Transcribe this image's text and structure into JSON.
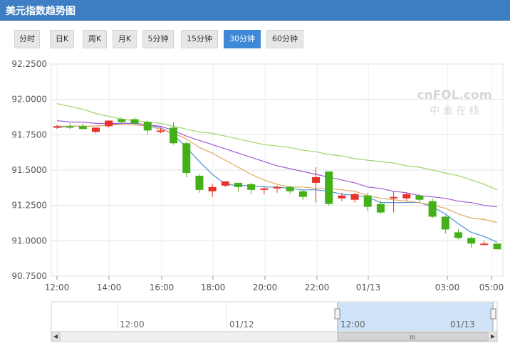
{
  "title": "美元指数趋势图",
  "tabs": [
    {
      "label": "分时",
      "active": false
    },
    {
      "label": "日K",
      "active": false
    },
    {
      "label": "周K",
      "active": false
    },
    {
      "label": "月K",
      "active": false
    },
    {
      "label": "5分钟",
      "active": false
    },
    {
      "label": "15分钟",
      "active": false
    },
    {
      "label": "30分钟",
      "active": true
    },
    {
      "label": "60分钟",
      "active": false
    }
  ],
  "watermark": {
    "brand": "cnFOL.com",
    "subtitle": "中 金 在 线"
  },
  "colors": {
    "up": "#e8312b",
    "down": "#43b017",
    "ma1": "#4a90d9",
    "ma2": "#e0a85a",
    "ma3": "#a55ad6",
    "ma4": "#9ed46b",
    "tab_active": "#3f88d8",
    "title_bar": "#3d7ec4"
  },
  "navigator": {
    "labels": [
      "12:00",
      "01/12",
      "12:00",
      "01/13"
    ],
    "scroll_grip": "III"
  },
  "chart_data": {
    "type": "candlestick",
    "ylim": [
      90.75,
      92.25
    ],
    "yticks": [
      "92.2500",
      "92.0000",
      "91.7500",
      "91.5000",
      "91.2500",
      "91.0000",
      "90.7500"
    ],
    "xticks": [
      "12:00",
      "14:00",
      "16:00",
      "18:00",
      "20:00",
      "22:00",
      "01/13",
      "03:00",
      "05:00"
    ],
    "candles": [
      {
        "o": 91.8,
        "h": 91.82,
        "l": 91.79,
        "c": 91.81
      },
      {
        "o": 91.81,
        "h": 91.83,
        "l": 91.79,
        "c": 91.8
      },
      {
        "o": 91.81,
        "h": 91.83,
        "l": 91.79,
        "c": 91.79
      },
      {
        "o": 91.77,
        "h": 91.8,
        "l": 91.76,
        "c": 91.8
      },
      {
        "o": 91.81,
        "h": 91.85,
        "l": 91.8,
        "c": 91.85
      },
      {
        "o": 91.86,
        "h": 91.87,
        "l": 91.83,
        "c": 91.84
      },
      {
        "o": 91.86,
        "h": 91.87,
        "l": 91.82,
        "c": 91.83
      },
      {
        "o": 91.84,
        "h": 91.85,
        "l": 91.75,
        "c": 91.78
      },
      {
        "o": 91.78,
        "h": 91.8,
        "l": 91.76,
        "c": 91.78
      },
      {
        "o": 91.8,
        "h": 91.84,
        "l": 91.68,
        "c": 91.69
      },
      {
        "o": 91.69,
        "h": 91.7,
        "l": 91.45,
        "c": 91.48
      },
      {
        "o": 91.46,
        "h": 91.47,
        "l": 91.34,
        "c": 91.36
      },
      {
        "o": 91.35,
        "h": 91.4,
        "l": 91.31,
        "c": 91.38
      },
      {
        "o": 91.39,
        "h": 91.42,
        "l": 91.38,
        "c": 91.42
      },
      {
        "o": 91.41,
        "h": 91.41,
        "l": 91.35,
        "c": 91.38
      },
      {
        "o": 91.4,
        "h": 91.41,
        "l": 91.33,
        "c": 91.36
      },
      {
        "o": 91.36,
        "h": 91.38,
        "l": 91.33,
        "c": 91.37
      },
      {
        "o": 91.37,
        "h": 91.39,
        "l": 91.34,
        "c": 91.38
      },
      {
        "o": 91.38,
        "h": 91.39,
        "l": 91.33,
        "c": 91.35
      },
      {
        "o": 91.35,
        "h": 91.36,
        "l": 91.29,
        "c": 91.31
      },
      {
        "o": 91.41,
        "h": 91.52,
        "l": 91.27,
        "c": 91.45
      },
      {
        "o": 91.49,
        "h": 91.49,
        "l": 91.25,
        "c": 91.26
      },
      {
        "o": 91.3,
        "h": 91.34,
        "l": 91.28,
        "c": 91.32
      },
      {
        "o": 91.29,
        "h": 91.34,
        "l": 91.27,
        "c": 91.33
      },
      {
        "o": 91.32,
        "h": 91.34,
        "l": 91.21,
        "c": 91.24
      },
      {
        "o": 91.26,
        "h": 91.28,
        "l": 91.19,
        "c": 91.2
      },
      {
        "o": 91.3,
        "h": 91.35,
        "l": 91.2,
        "c": 91.31
      },
      {
        "o": 91.3,
        "h": 91.34,
        "l": 91.28,
        "c": 91.33
      },
      {
        "o": 91.32,
        "h": 91.33,
        "l": 91.27,
        "c": 91.29
      },
      {
        "o": 91.28,
        "h": 91.3,
        "l": 91.16,
        "c": 91.17
      },
      {
        "o": 91.17,
        "h": 91.18,
        "l": 91.05,
        "c": 91.08
      },
      {
        "o": 91.06,
        "h": 91.08,
        "l": 91.01,
        "c": 91.02
      },
      {
        "o": 91.02,
        "h": 91.03,
        "l": 90.95,
        "c": 90.98
      },
      {
        "o": 90.98,
        "h": 91.0,
        "l": 90.97,
        "c": 90.98
      },
      {
        "o": 90.98,
        "h": 90.98,
        "l": 90.94,
        "c": 90.94
      }
    ],
    "ma_lines": [
      {
        "color": "ma1",
        "values": [
          91.8,
          91.81,
          91.81,
          91.81,
          91.82,
          91.83,
          91.83,
          91.82,
          91.8,
          91.75,
          91.66,
          91.56,
          91.47,
          91.4,
          91.39,
          91.39,
          91.38,
          91.38,
          91.37,
          91.36,
          91.36,
          91.35,
          91.33,
          91.32,
          91.31,
          91.27,
          91.27,
          91.27,
          91.27,
          91.24,
          91.19,
          91.12,
          91.06,
          91.03,
          90.99
        ]
      },
      {
        "color": "ma2",
        "values": [
          91.81,
          91.81,
          91.81,
          91.81,
          91.82,
          91.82,
          91.82,
          91.81,
          91.79,
          91.76,
          91.72,
          91.66,
          91.62,
          91.57,
          91.52,
          91.47,
          91.43,
          91.4,
          91.38,
          91.38,
          91.37,
          91.37,
          91.36,
          91.35,
          91.32,
          91.3,
          91.29,
          91.28,
          91.27,
          91.25,
          91.23,
          91.19,
          91.16,
          91.15,
          91.13
        ]
      },
      {
        "color": "ma3",
        "values": [
          91.85,
          91.84,
          91.84,
          91.83,
          91.83,
          91.83,
          91.83,
          91.82,
          91.81,
          91.78,
          91.74,
          91.71,
          91.68,
          91.65,
          91.62,
          91.59,
          91.56,
          91.53,
          91.51,
          91.49,
          91.47,
          91.45,
          91.43,
          91.41,
          91.38,
          91.37,
          91.35,
          91.34,
          91.32,
          91.31,
          91.3,
          91.28,
          91.27,
          91.25,
          91.24
        ]
      },
      {
        "color": "ma4",
        "values": [
          91.97,
          91.95,
          91.93,
          91.9,
          91.88,
          91.86,
          91.85,
          91.84,
          91.83,
          91.81,
          91.79,
          91.77,
          91.76,
          91.74,
          91.72,
          91.7,
          91.68,
          91.67,
          91.66,
          91.64,
          91.63,
          91.61,
          91.6,
          91.58,
          91.57,
          91.56,
          91.55,
          91.53,
          91.52,
          91.5,
          91.48,
          91.46,
          91.43,
          91.4,
          91.36
        ]
      }
    ]
  }
}
